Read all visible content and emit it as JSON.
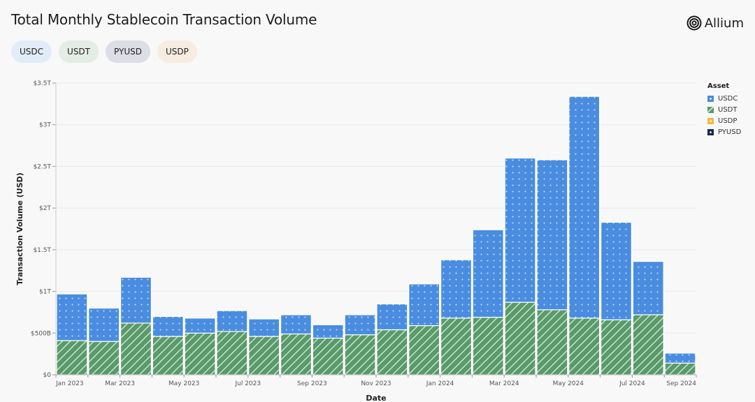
{
  "header": {
    "title": "Total Monthly Stablecoin Transaction Volume",
    "logo_text": "Allium"
  },
  "filters": [
    {
      "label": "USDC",
      "color": "#e2ecf8"
    },
    {
      "label": "USDT",
      "color": "#e4ece6"
    },
    {
      "label": "PYUSD",
      "color": "#dcdde5"
    },
    {
      "label": "USDP",
      "color": "#f7ece0"
    }
  ],
  "legend": {
    "title": "Asset",
    "items": [
      {
        "label": "USDC",
        "color": "#4a8de0",
        "icon": "dot-pattern-square"
      },
      {
        "label": "USDT",
        "color": "#5a9a6a",
        "icon": "hatch-pattern-square"
      },
      {
        "label": "USDP",
        "color": "#f0b84a",
        "icon": "cross-pattern-square"
      },
      {
        "label": "PYUSD",
        "color": "#1a2a4a",
        "icon": "dot-pattern-square"
      }
    ]
  },
  "chart_data": {
    "type": "bar",
    "stacked": true,
    "title": "Total Monthly Stablecoin Transaction Volume",
    "xlabel": "Date",
    "ylabel": "Transaction Volume (USD)",
    "ylim": [
      0,
      3.5
    ],
    "y_unit": "trillion USD",
    "y_ticks": [
      0,
      0.5,
      1,
      1.5,
      2,
      2.5,
      3,
      3.5
    ],
    "y_tick_labels": [
      "$0",
      "$500B",
      "$1T",
      "$1.5T",
      "$2T",
      "$2.5T",
      "$3T",
      "$3.5T"
    ],
    "grid": true,
    "legend_position": "right",
    "categories": [
      "Jan 2023",
      "Feb 2023",
      "Mar 2023",
      "Apr 2023",
      "May 2023",
      "Jun 2023",
      "Jul 2023",
      "Aug 2023",
      "Sep 2023",
      "Oct 2023",
      "Nov 2023",
      "Dec 2023",
      "Jan 2024",
      "Feb 2024",
      "Mar 2024",
      "Apr 2024",
      "May 2024",
      "Jun 2024",
      "Jul 2024",
      "Aug 2024"
    ],
    "x_tick_labels": [
      "Jan 2023",
      "Mar 2023",
      "May 2023",
      "Jul 2023",
      "Sep 2023",
      "Nov 2023",
      "Jan 2024",
      "Mar 2024",
      "May 2024",
      "Jul 2024",
      "Sep 2024"
    ],
    "series": [
      {
        "name": "USDT",
        "color": "#5a9a6a",
        "values": [
          0.41,
          0.4,
          0.62,
          0.46,
          0.5,
          0.52,
          0.46,
          0.49,
          0.44,
          0.48,
          0.54,
          0.59,
          0.68,
          0.69,
          0.87,
          0.78,
          0.68,
          0.66,
          0.72,
          0.14
        ]
      },
      {
        "name": "USDC",
        "color": "#4a8de0",
        "values": [
          0.56,
          0.4,
          0.55,
          0.24,
          0.18,
          0.25,
          0.21,
          0.23,
          0.16,
          0.24,
          0.31,
          0.5,
          0.7,
          1.05,
          1.73,
          1.8,
          2.66,
          1.17,
          0.64,
          0.12
        ]
      },
      {
        "name": "USDP",
        "color": "#f0b84a",
        "values": [
          0,
          0,
          0,
          0,
          0,
          0,
          0,
          0,
          0,
          0,
          0,
          0,
          0,
          0,
          0,
          0,
          0,
          0,
          0,
          0
        ]
      },
      {
        "name": "PYUSD",
        "color": "#1a2a4a",
        "values": [
          0,
          0,
          0,
          0,
          0,
          0,
          0,
          0,
          0,
          0,
          0,
          0,
          0,
          0,
          0,
          0,
          0,
          0,
          0,
          0
        ]
      }
    ]
  }
}
